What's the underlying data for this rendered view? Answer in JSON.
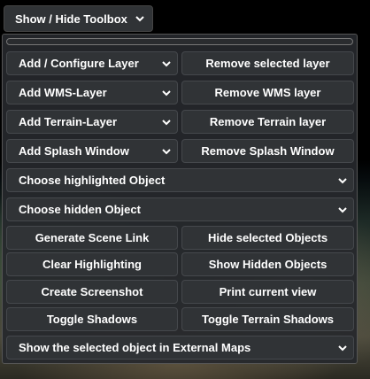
{
  "toolbox_toggle": {
    "label": "Show / Hide Toolbox"
  },
  "toolbox": {
    "add_configure_layer": "Add / Configure Layer",
    "remove_selected_layer": "Remove selected layer",
    "add_wms_layer": "Add WMS-Layer",
    "remove_wms_layer": "Remove WMS layer",
    "add_terrain_layer": "Add Terrain-Layer",
    "remove_terrain_layer": "Remove Terrain layer",
    "add_splash_window": "Add Splash Window",
    "remove_splash_window": "Remove Splash Window",
    "choose_highlighted_object": "Choose highlighted Object",
    "choose_hidden_object": "Choose hidden Object",
    "generate_scene_link": "Generate Scene Link",
    "hide_selected_objects": "Hide selected Objects",
    "clear_highlighting": "Clear Highlighting",
    "show_hidden_objects": "Show Hidden Objects",
    "create_screenshot": "Create Screenshot",
    "print_current_view": "Print current view",
    "toggle_shadows": "Toggle Shadows",
    "toggle_terrain_shadows": "Toggle Terrain Shadows",
    "external_maps": "Show the selected object in External Maps"
  },
  "icons": {
    "dropdown": "chevron-down-icon"
  },
  "colors": {
    "button_bg": "#303336",
    "panel_bg": "#26282c",
    "text": "#ffffff"
  }
}
